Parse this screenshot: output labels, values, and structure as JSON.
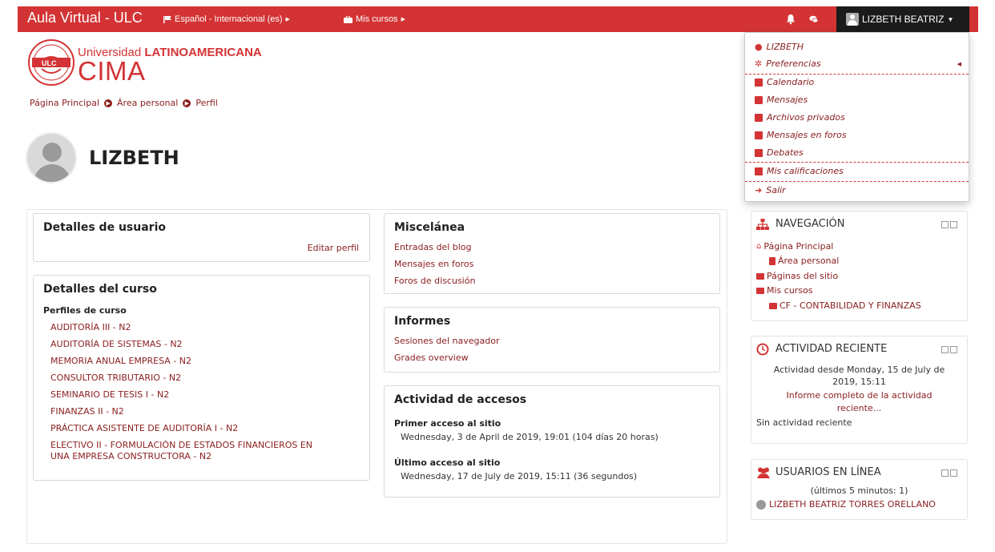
{
  "navbar": {
    "brand": "Aula Virtual - ULC",
    "language": "Español - Internacional (es)",
    "my_courses": "Mis cursos",
    "user_name": "LIZBETH BEATRIZ"
  },
  "logo": {
    "line1_a": "Universidad ",
    "line1_b": "LATINOAMERICANA",
    "line2": "CIMA",
    "badge": "ULC"
  },
  "breadcrumb": [
    "Página Principal",
    "Área personal",
    "Perfil"
  ],
  "profile": {
    "name": "LIZBETH"
  },
  "user_details": {
    "title": "Detalles de usuario",
    "edit_link": "Editar perfil"
  },
  "course_details": {
    "title": "Detalles del curso",
    "subtitle": "Perfiles de curso",
    "courses": [
      "AUDITORÍA III - N2",
      "AUDITORÍA DE SISTEMAS - N2",
      "MEMORIA ANUAL EMPRESA - N2",
      "CONSULTOR TRIBUTARIO - N2",
      "SEMINARIO DE TESIS I - N2",
      "FINANZAS II - N2",
      "PRÁCTICA ASISTENTE DE AUDITORÍA I - N2",
      "ELECTIVO II - FORMULACIÓN DE ESTADOS FINANCIEROS EN",
      "UNA EMPRESA CONSTRUCTORA - N2"
    ]
  },
  "misc": {
    "title": "Miscelánea",
    "links": [
      "Entradas del blog",
      "Mensajes en foros",
      "Foros de discusión"
    ]
  },
  "reports": {
    "title": "Informes",
    "links": [
      "Sesiones del navegador",
      "Grades overview"
    ]
  },
  "access": {
    "title": "Actividad de accesos",
    "first_label": "Primer acceso al sitio",
    "first_value": "Wednesday, 3 de April de 2019, 19:01  (104 días 20 horas)",
    "last_label": "Último acceso al sitio",
    "last_value": "Wednesday, 17 de July de 2019, 15:11  (36 segundos)"
  },
  "navigation_block": {
    "title": "NAVEGACIÓN",
    "items": [
      "Página Principal",
      "Área personal",
      "Páginas del sitio",
      "Mis cursos",
      "CF - CONTABILIDAD Y FINANZAS"
    ]
  },
  "recent_block": {
    "title": "ACTIVIDAD RECIENTE",
    "line1": "Actividad desde Monday, 15 de July de",
    "line2": "2019, 15:11",
    "line3": "Informe completo de la actividad",
    "line4": "reciente...",
    "none": "Sin actividad reciente"
  },
  "online_block": {
    "title": "USUARIOS EN LÍNEA",
    "subtitle": "(últimos 5 minutos: 1)",
    "user": "LIZBETH BEATRIZ TORRES ORELLANO"
  },
  "dropdown": {
    "items": [
      "LIZBETH",
      "Preferencias",
      "Calendario",
      "Mensajes",
      "Archivos privados",
      "Mensajes en foros",
      "Debates",
      "Mis calificaciones",
      "Salir"
    ]
  },
  "colors": {
    "brand": "#d33334",
    "link": "#8b2020",
    "toggle": "#1b1b1b"
  }
}
